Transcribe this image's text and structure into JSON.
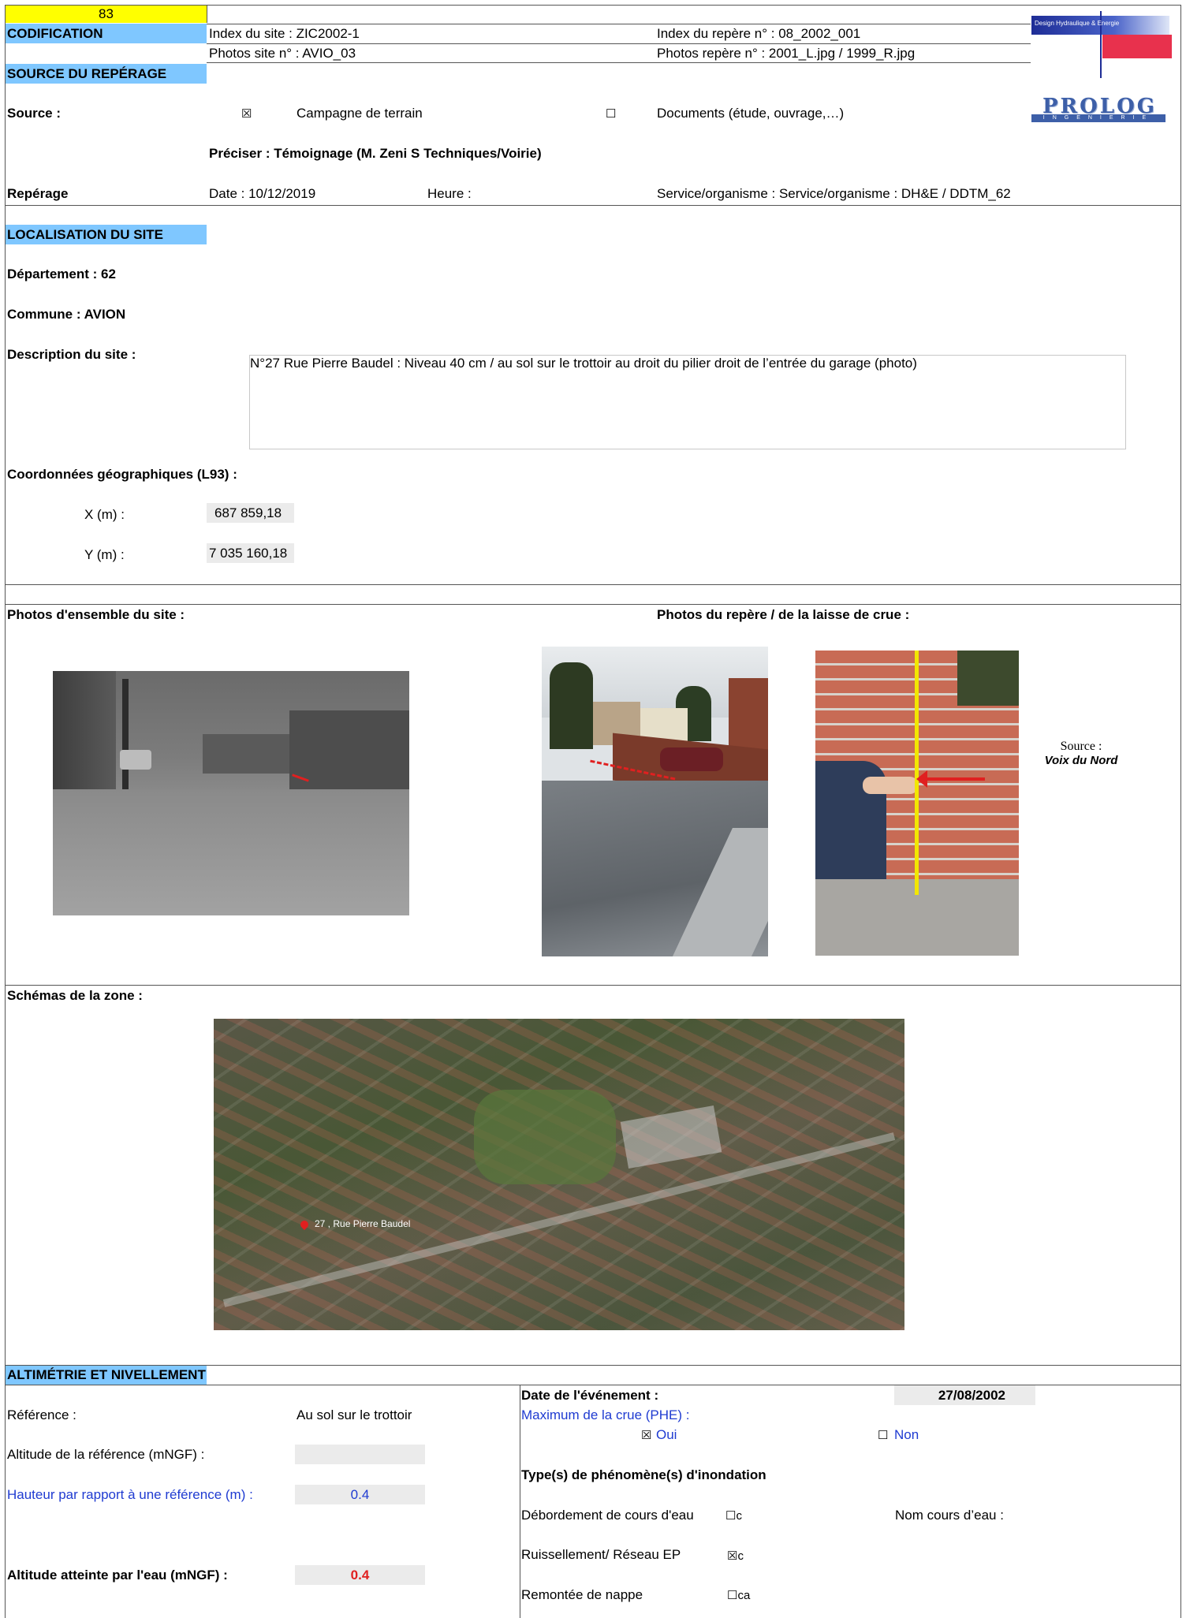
{
  "header": {
    "number": "83",
    "codification_label": "CODIFICATION",
    "index_site": "Index du site : ZIC2002-1",
    "index_repere": "Index du repère n° : 08_2002_001",
    "photos_site": "Photos site n° : AVIO_03",
    "photos_repere": "Photos repère n° : 2001_L.jpg  / 1999_R.jpg"
  },
  "logos": {
    "dhe_text": "Design Hydraulique & Energie",
    "prolog_text": "PROLOG",
    "prolog_sub": "INGENIERIE"
  },
  "source_section": {
    "title": "SOURCE DU REPÉRAGE",
    "source_label": "Source :",
    "option1_box": "☒",
    "option1_label": "Campagne de terrain",
    "option2_box": "☐",
    "option2_label": "Documents (étude, ouvrage,…)",
    "preciser": "Préciser : Témoignage (M. Zeni  S Techniques/Voirie)",
    "reperage_label": "Repérage",
    "date": "Date : 10/12/2019",
    "heure": "Heure :",
    "service": "Service/organisme : Service/organisme : DH&E / DDTM_62"
  },
  "localisation": {
    "title": "LOCALISATION DU SITE",
    "departement": "Département :  62",
    "commune": "Commune : AVION",
    "description_label": "Description du site :",
    "description": "N°27 Rue Pierre Baudel : Niveau 40 cm / au sol sur le trottoir au droit du pilier droit de l’entrée du garage (photo)",
    "coords_label": "Coordonnées géographiques (L93) :",
    "x_label": "X (m) :",
    "x_value": "687 859,18",
    "y_label": "Y (m) :",
    "y_value": "7 035 160,18"
  },
  "photos": {
    "ensemble_label": "Photos d'ensemble du site :",
    "repere_label": "Photos du repère / de la laisse de crue  :",
    "source_label": "Source :",
    "source_name": "Voix du Nord"
  },
  "schemas": {
    "label": "Schémas de la zone :",
    "map_marker": "27 , Rue Pierre Baudel"
  },
  "altimetrie": {
    "title": "ALTIMÉTRIE ET NIVELLEMENT",
    "reference_label": "Référence :",
    "reference_value": "Au sol sur le trottoir",
    "altitude_ref_label": "Altitude de la référence (mNGF)  :",
    "altitude_ref_value": "",
    "hauteur_label": "Hauteur par rapport à une référence (m) :",
    "hauteur_value": "0.4",
    "altitude_eau_label": "Altitude atteinte par l'eau (mNGF) :",
    "altitude_eau_value": "0.4",
    "date_event_label": "Date de l'événement :",
    "date_event_value": "27/08/2002",
    "phe_label": "Maximum de la crue (PHE) :",
    "oui_box": "☒",
    "oui_label": "Oui",
    "non_box": "☐",
    "non_label": "Non",
    "types_label": "Type(s) de phénomène(s) d'inondation",
    "debordement_label": "Débordement de cours d'eau",
    "debordement_box": "☐c",
    "nom_cours_label": "Nom cours d’eau :",
    "ruissellement_label": "Ruissellement/ Réseau EP",
    "ruissellement_box": "☒c",
    "remontee_label": "Remontée de nappe",
    "remontee_box": "☐ca"
  },
  "colors": {
    "section_bar": "#7fc7ff",
    "number_bar": "#ffff00",
    "field_gray": "#ebebeb",
    "blue_text": "#1f3bd1",
    "red_value": "#e02020"
  }
}
